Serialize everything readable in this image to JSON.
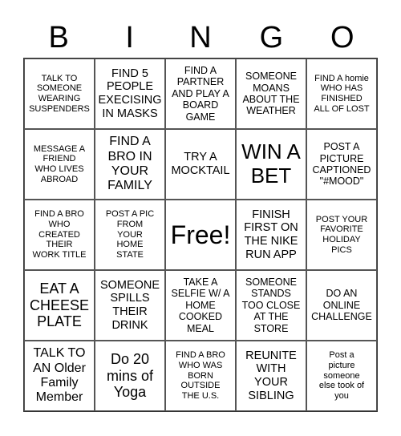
{
  "header": {
    "letters": [
      "B",
      "I",
      "N",
      "G",
      "O"
    ]
  },
  "cells": [
    "TALK TO\nSOMEONE\nWEARING\nSUSPENDERS",
    "FIND 5\nPEOPLE\nEXECISING\nIN MASKS",
    "FIND A\nPARTNER\nAND PLAY A\nBOARD\nGAME",
    "SOMEONE\nMOANS\nABOUT THE\nWEATHER",
    "FIND A homie\nWHO HAS\nFINISHED\nALL OF LOST",
    "MESSAGE A\nFRIEND\nWHO LIVES\nABROAD",
    "FIND A\nBRO IN\nYOUR\nFAMILY",
    "TRY A\nMOCKTAIL",
    "WIN A\nBET",
    "POST A\nPICTURE\nCAPTIONED\n\"#MOOD\"",
    "FIND A BRO\nWHO\nCREATED\nTHEIR\nWORK TITLE",
    "POST A PIC\nFROM\nYOUR\nHOME\nSTATE",
    "Free!",
    "FINISH\nFIRST ON\nTHE NIKE\nRUN APP",
    "POST YOUR\nFAVORITE\nHOLIDAY\nPICS",
    "EAT A\nCHEESE\nPLATE",
    "SOMEONE\nSPILLS\nTHEIR\nDRINK",
    "TAKE A\nSELFIE W/ A\nHOME\nCOOKED\nMEAL",
    "SOMEONE\nSTANDS\nTOO CLOSE\nAT THE\nSTORE",
    "DO AN\nONLINE\nCHALLENGE",
    "TALK TO\nAN Older\nFamily\nMember",
    "Do 20\nmins of\nYoga",
    "FIND A BRO\nWHO WAS\nBORN\nOUTSIDE\nTHE U.S.",
    "REUNITE\nWITH\nYOUR\nSIBLING",
    "Post a\npicture\nsomeone\nelse took of\nyou"
  ]
}
